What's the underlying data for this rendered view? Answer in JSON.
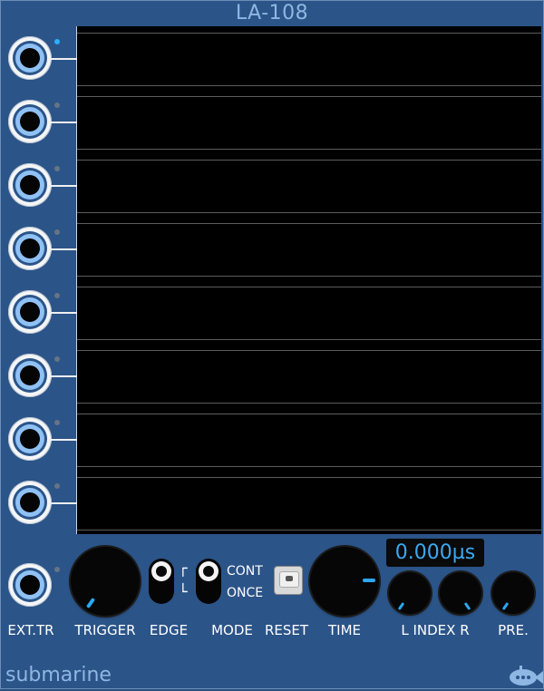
{
  "module": {
    "title": "LA-108",
    "brand": "submarine"
  },
  "channels": [
    {
      "led": "on"
    },
    {
      "led": "off"
    },
    {
      "led": "off"
    },
    {
      "led": "off"
    },
    {
      "led": "off"
    },
    {
      "led": "off"
    },
    {
      "led": "off"
    },
    {
      "led": "off"
    }
  ],
  "controls": {
    "ext_tr_label": "EXT.TR",
    "trigger_label": "TRIGGER",
    "edge_label": "EDGE",
    "mode_label": "MODE",
    "mode_cont": "CONT",
    "mode_once": "ONCE",
    "reset_label": "RESET",
    "time_label": "TIME",
    "index_label": "L INDEX R",
    "pre_label": "PRE.",
    "display_value": "0.000µs"
  },
  "colors": {
    "panel": "#2b5488",
    "accent": "#2aa8f0",
    "display_text": "#3aa9f2"
  },
  "icons": {
    "logo": "submarine-fish-icon"
  }
}
